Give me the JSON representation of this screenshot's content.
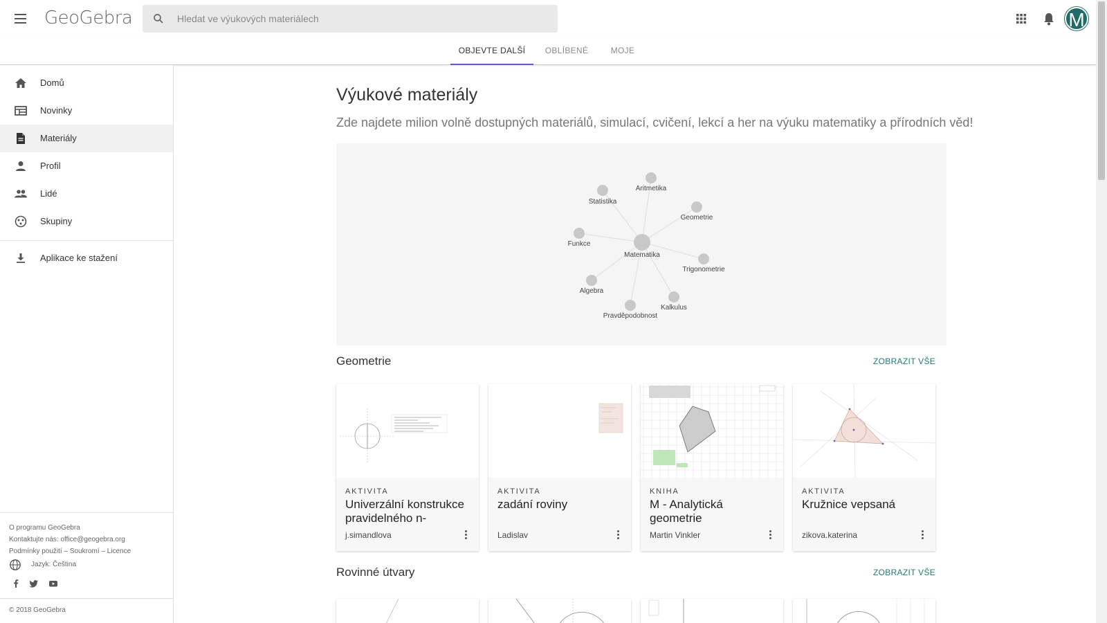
{
  "header": {
    "logo": "GeoGebra",
    "search_placeholder": "Hledat ve výukových materiálech",
    "avatar_letter": "M"
  },
  "tabs": [
    {
      "label": "OBJEVTE DALŠÍ",
      "active": true
    },
    {
      "label": "OBLÍBENÉ",
      "active": false
    },
    {
      "label": "MOJE",
      "active": false
    }
  ],
  "sidebar": {
    "items": [
      {
        "label": "Domů",
        "icon": "home-icon"
      },
      {
        "label": "Novinky",
        "icon": "news-icon"
      },
      {
        "label": "Materiály",
        "icon": "document-icon",
        "active": true
      },
      {
        "label": "Profil",
        "icon": "person-icon"
      },
      {
        "label": "Lidé",
        "icon": "people-icon"
      },
      {
        "label": "Skupiny",
        "icon": "groups-icon"
      }
    ],
    "download": {
      "label": "Aplikace ke stažení",
      "icon": "download-icon"
    },
    "footer": {
      "about": "O programu GeoGebra",
      "contact": "Kontaktujte nás: office@geogebra.org",
      "terms": "Podmínky použití – Soukromí – Licence",
      "language": "Jazyk: Čeština",
      "copyright": "© 2018 GeoGebra"
    }
  },
  "main": {
    "title": "Výukové materiály",
    "subtitle": "Zde najdete milion volně dostupných materiálů, simulací, cvičení, lekcí a her na výuku matematiky a přírodních věd!",
    "graph": {
      "center": "Matematika",
      "nodes": [
        "Aritmetika",
        "Statistika",
        "Geometrie",
        "Funkce",
        "Trigonometrie",
        "Algebra",
        "Kalkulus",
        "Pravděpodobnost"
      ]
    },
    "sections": [
      {
        "title": "Geometrie",
        "show_all": "ZOBRAZIT VŠE",
        "cards": [
          {
            "type": "AKTIVITA",
            "title": "Univerzální konstrukce pravidelného n-",
            "author": "j.simandlova"
          },
          {
            "type": "AKTIVITA",
            "title": "zadání roviny",
            "author": "Ladislav"
          },
          {
            "type": "KNIHA",
            "title": "M - Analytická geometrie",
            "author": "Martin Vinkler"
          },
          {
            "type": "AKTIVITA",
            "title": "Kružnice vepsaná",
            "author": "zikova.katerina"
          }
        ]
      },
      {
        "title": "Rovinné útvary",
        "show_all": "ZOBRAZIT VŠE"
      }
    ]
  },
  "colors": {
    "accent": "#6557d2",
    "link": "#1c7c76",
    "avatar": "#1e6b68"
  }
}
